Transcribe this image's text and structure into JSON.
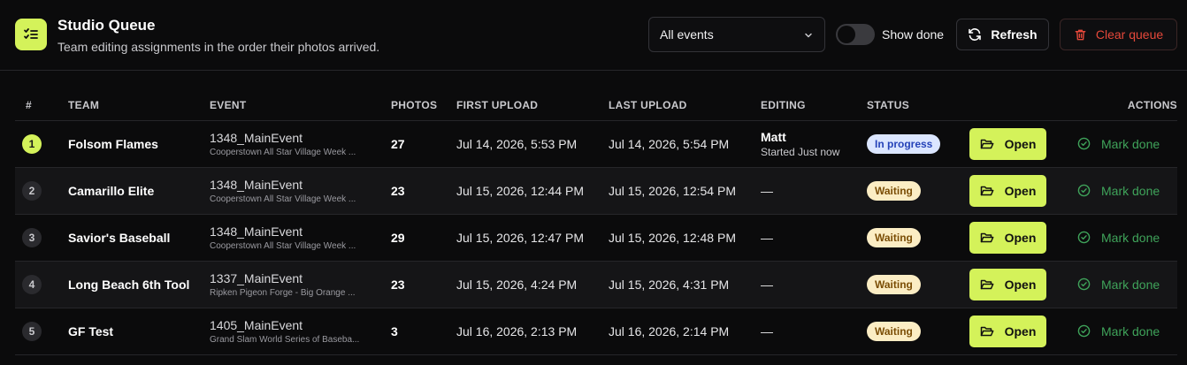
{
  "header": {
    "title": "Studio Queue",
    "subtitle": "Team editing assignments in the order their photos arrived.",
    "icon": "checklist-icon",
    "accent": "#d4f25a"
  },
  "toolbar": {
    "event_filter": "All events",
    "show_done_label": "Show done",
    "show_done_on": false,
    "refresh_label": "Refresh",
    "clear_label": "Clear queue"
  },
  "table": {
    "columns": {
      "num": "#",
      "team": "TEAM",
      "event": "EVENT",
      "photos": "PHOTOS",
      "first_upload": "FIRST UPLOAD",
      "last_upload": "LAST UPLOAD",
      "editing": "EDITING",
      "status": "STATUS",
      "actions": "ACTIONS"
    },
    "open_label": "Open",
    "mark_done_label": "Mark done",
    "rows": [
      {
        "rank": "1",
        "team": "Folsom Flames",
        "event": "1348_MainEvent",
        "event_sub": "Cooperstown All Star Village Week ...",
        "photos": "27",
        "first_upload": "Jul 14, 2026, 5:53 PM",
        "last_upload": "Jul 14, 2026, 5:54 PM",
        "editor": "Matt",
        "editor_sub": "Started Just now",
        "status": "In progress"
      },
      {
        "rank": "2",
        "team": "Camarillo Elite",
        "event": "1348_MainEvent",
        "event_sub": "Cooperstown All Star Village Week ...",
        "photos": "23",
        "first_upload": "Jul 15, 2026, 12:44 PM",
        "last_upload": "Jul 15, 2026, 12:54 PM",
        "editor": "—",
        "status": "Waiting"
      },
      {
        "rank": "3",
        "team": "Savior's Baseball",
        "event": "1348_MainEvent",
        "event_sub": "Cooperstown All Star Village Week ...",
        "photos": "29",
        "first_upload": "Jul 15, 2026, 12:47 PM",
        "last_upload": "Jul 15, 2026, 12:48 PM",
        "editor": "—",
        "status": "Waiting"
      },
      {
        "rank": "4",
        "team": "Long Beach 6th Tool",
        "event": "1337_MainEvent",
        "event_sub": "Ripken Pigeon Forge - Big Orange ...",
        "photos": "23",
        "first_upload": "Jul 15, 2026, 4:24 PM",
        "last_upload": "Jul 15, 2026, 4:31 PM",
        "editor": "—",
        "status": "Waiting"
      },
      {
        "rank": "5",
        "team": "GF Test",
        "event": "1405_MainEvent",
        "event_sub": "Grand Slam World Series of Baseba...",
        "photos": "3",
        "first_upload": "Jul 16, 2026, 2:13 PM",
        "last_upload": "Jul 16, 2026, 2:14 PM",
        "editor": "—",
        "status": "Waiting"
      }
    ]
  }
}
